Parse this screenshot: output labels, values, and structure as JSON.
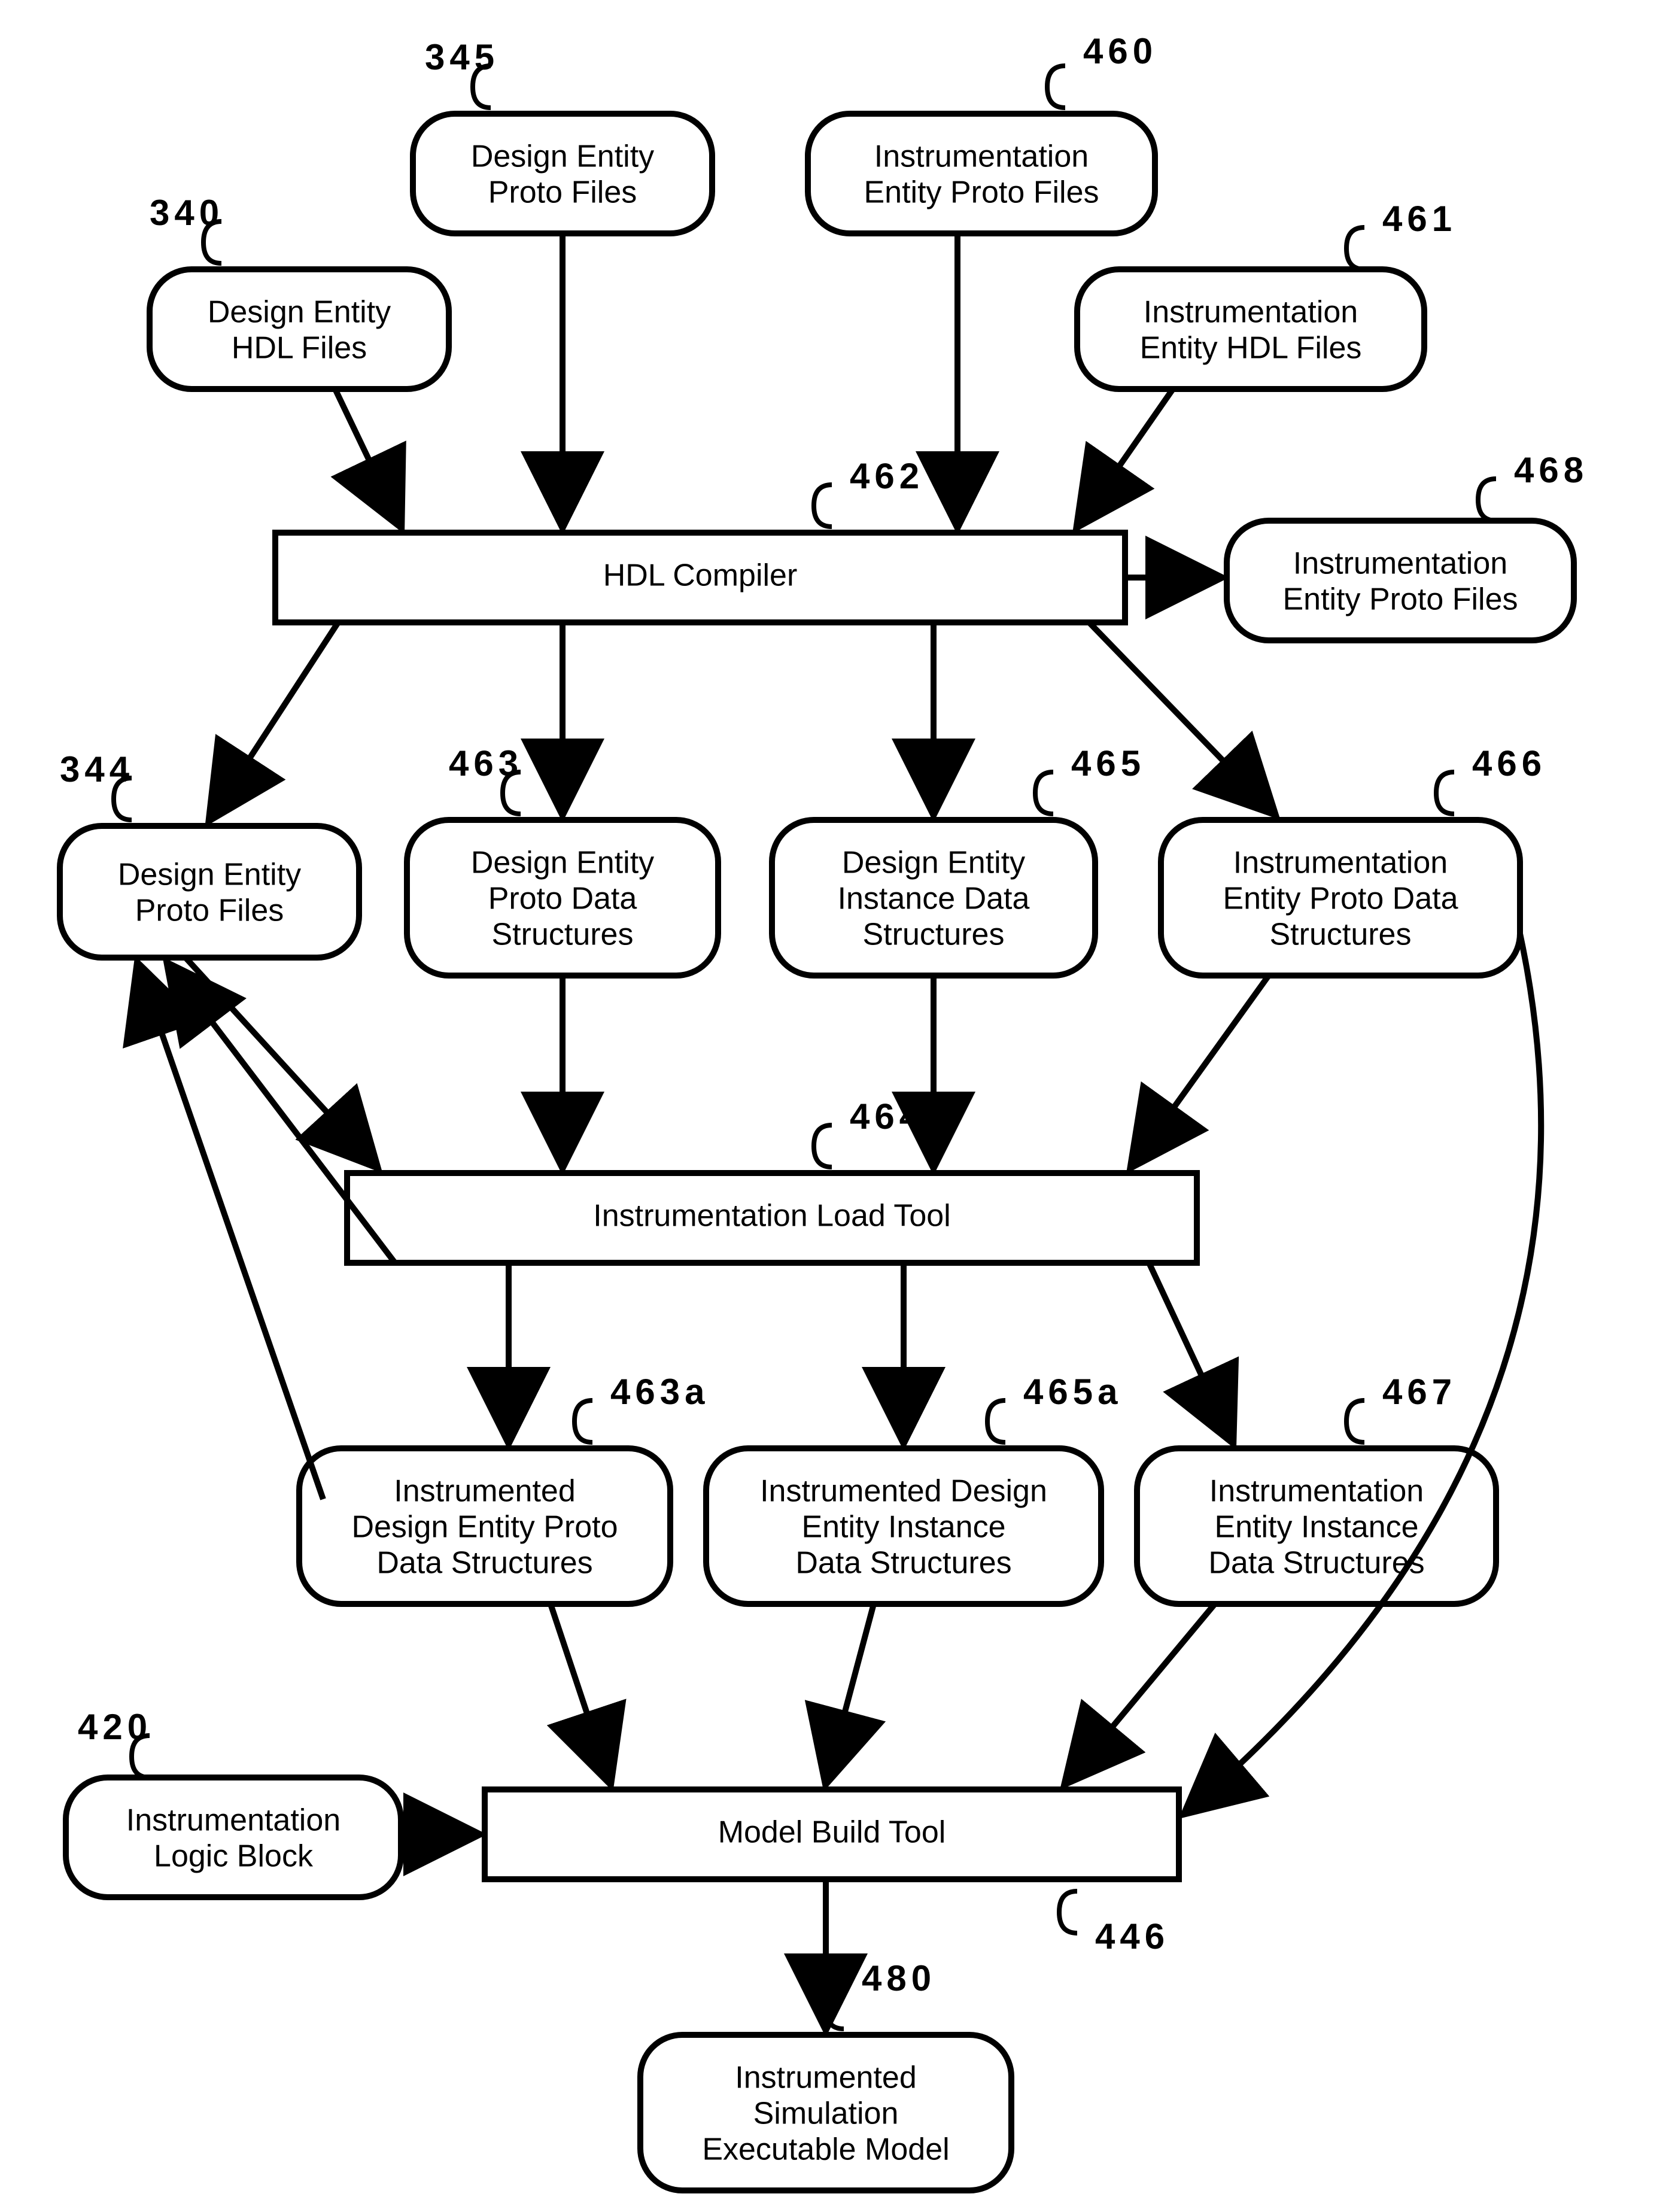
{
  "nodes": {
    "n340": {
      "ref": "340",
      "lines": [
        "Design Entity",
        "HDL Files"
      ]
    },
    "n345": {
      "ref": "345",
      "lines": [
        "Design Entity",
        "Proto Files"
      ]
    },
    "n460": {
      "ref": "460",
      "lines": [
        "Instrumentation",
        "Entity Proto Files"
      ]
    },
    "n461": {
      "ref": "461",
      "lines": [
        "Instrumentation",
        "Entity HDL Files"
      ]
    },
    "n462": {
      "ref": "462",
      "lines": [
        "HDL Compiler"
      ]
    },
    "n468": {
      "ref": "468",
      "lines": [
        "Instrumentation",
        "Entity Proto Files"
      ]
    },
    "n344": {
      "ref": "344",
      "lines": [
        "Design Entity",
        "Proto Files"
      ]
    },
    "n463": {
      "ref": "463",
      "lines": [
        "Design Entity",
        "Proto Data",
        "Structures"
      ]
    },
    "n465": {
      "ref": "465",
      "lines": [
        "Design Entity",
        "Instance Data",
        "Structures"
      ]
    },
    "n466": {
      "ref": "466",
      "lines": [
        "Instrumentation",
        "Entity Proto Data",
        "Structures"
      ]
    },
    "n464": {
      "ref": "464",
      "lines": [
        "Instrumentation Load Tool"
      ]
    },
    "n463a": {
      "ref": "463a",
      "lines": [
        "Instrumented",
        "Design Entity Proto",
        "Data Structures"
      ]
    },
    "n465a": {
      "ref": "465a",
      "lines": [
        "Instrumented Design",
        "Entity Instance",
        "Data Structures"
      ]
    },
    "n467": {
      "ref": "467",
      "lines": [
        "Instrumentation",
        "Entity Instance",
        "Data Structures"
      ]
    },
    "n420": {
      "ref": "420",
      "lines": [
        "Instrumentation",
        "Logic Block"
      ]
    },
    "n446": {
      "ref": "446",
      "lines": [
        "Model Build Tool"
      ]
    },
    "n480": {
      "ref": "480",
      "lines": [
        "Instrumented",
        "Simulation",
        "Executable Model"
      ]
    }
  }
}
